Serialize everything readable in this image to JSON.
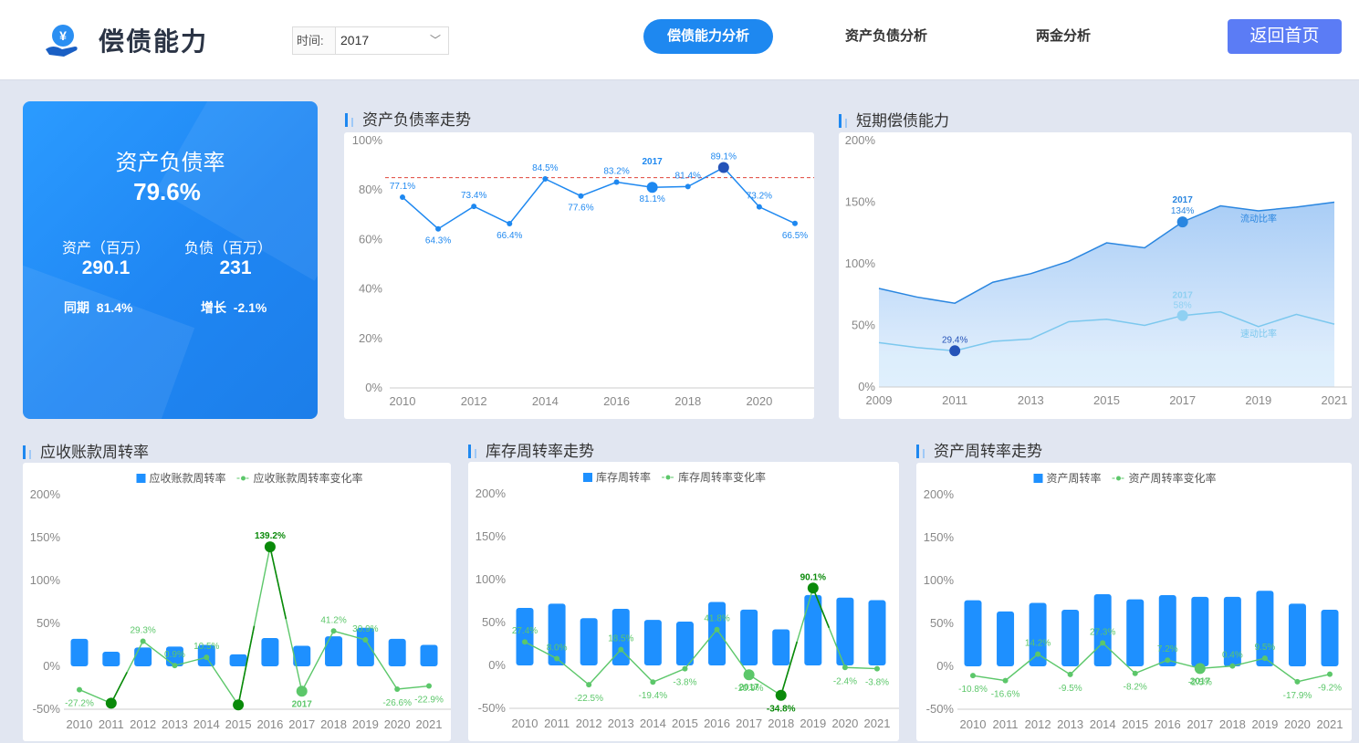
{
  "header": {
    "app_title": "偿债能力",
    "time_label": "时间:",
    "time_value": "2017",
    "tabs": [
      "偿债能力分析",
      "资产负债分析",
      "两金分析"
    ],
    "home_button": "返回首页",
    "logo_icon": "yuan-hand-icon"
  },
  "kpi": {
    "title": "资产负债率",
    "main_value": "79.6%",
    "assets_label": "资产（百万）",
    "assets_value": "290.1",
    "liabilities_label": "负债（百万）",
    "liabilities_value": "231",
    "yoy_label": "同期",
    "yoy_value": "81.4%",
    "growth_label": "增长",
    "growth_value": "-2.1%"
  },
  "titles": {
    "debt_ratio": "资产负债率走势",
    "short_term": "短期偿债能力",
    "receivable": "应收账款周转率",
    "inventory": "库存周转率走势",
    "asset_turnover": "资产周转率走势"
  },
  "colors": {
    "accent": "#1e88f0",
    "bar": "#1e90ff",
    "line_green": "#5cc76a",
    "highlight_green": "#0a8a0a",
    "dark_blue": "#2553b8",
    "warning_red": "#e0453a"
  },
  "chart_data": [
    {
      "type": "line",
      "id": "debt_ratio",
      "x": [
        2010,
        2011,
        2012,
        2013,
        2014,
        2015,
        2016,
        2017,
        2018,
        2019,
        2020,
        2021
      ],
      "series": [
        {
          "values": [
            77.1,
            64.3,
            73.4,
            66.4,
            84.5,
            77.6,
            83.2,
            81.1,
            81.4,
            89.1,
            73.2,
            66.5
          ]
        }
      ],
      "data_labels": [
        "77.1%",
        "64.3%",
        "73.4%",
        "66.4%",
        "84.5%",
        "77.6%",
        "83.2%",
        "81.1%",
        "81.4%",
        "89.1%",
        "73.2%",
        "66.5%"
      ],
      "x_ticks": [
        "2010",
        "2012",
        "2014",
        "2016",
        "2018",
        "2020"
      ],
      "y_ticks": [
        "0%",
        "20%",
        "40%",
        "60%",
        "80%",
        "100%"
      ],
      "ylim": [
        0,
        100
      ],
      "reference_line": 85,
      "highlight_year": "2017",
      "grid": false
    },
    {
      "type": "area",
      "id": "short_term",
      "x": [
        2009,
        2010,
        2011,
        2012,
        2013,
        2014,
        2015,
        2016,
        2017,
        2018,
        2019,
        2020,
        2021
      ],
      "series": [
        {
          "name": "流动比率",
          "values": [
            80,
            73,
            68,
            85,
            92,
            102,
            117,
            113,
            134,
            147,
            143,
            146,
            150
          ]
        },
        {
          "name": "速动比率",
          "values": [
            36,
            32,
            29.4,
            37,
            39,
            53,
            55,
            50,
            58,
            61,
            49,
            59,
            51
          ]
        }
      ],
      "x_ticks": [
        "2009",
        "2011",
        "2013",
        "2015",
        "2017",
        "2019",
        "2021"
      ],
      "y_ticks": [
        "0%",
        "50%",
        "100%",
        "150%",
        "200%"
      ],
      "ylim": [
        0,
        200
      ],
      "annotations": [
        {
          "year": "2017",
          "value_label": "134%",
          "series": "流动比率"
        },
        {
          "year": "2017",
          "value_label": "58%",
          "series": "速动比率"
        },
        {
          "value_label": "29.4%",
          "series": "速动比率",
          "at": 2011
        }
      ]
    },
    {
      "type": "bar",
      "id": "receivable",
      "x": [
        2010,
        2011,
        2012,
        2013,
        2014,
        2015,
        2016,
        2017,
        2018,
        2019,
        2020,
        2021
      ],
      "series": [
        {
          "name": "应收账款周转率",
          "values": [
            32,
            17,
            22,
            23,
            25,
            14,
            33,
            24,
            35,
            45,
            32,
            25
          ]
        },
        {
          "name": "应收账款周转率变化率",
          "values": [
            -27.2,
            -43,
            29.3,
            0.9,
            10.5,
            -45,
            139.2,
            -29,
            41.2,
            30.9,
            -26.6,
            -22.9
          ]
        }
      ],
      "labels": [
        "-27.2%",
        "",
        "29.3%",
        "0.9%",
        "10.5%",
        "",
        "139.2%",
        "",
        "41.2%",
        "30.9%",
        "-26.6%",
        "-22.9%"
      ],
      "highlight_year": "2017",
      "highlight_points": [
        1,
        5,
        6
      ],
      "y_ticks": [
        "-50%",
        "0%",
        "50%",
        "100%",
        "150%",
        "200%"
      ],
      "ylim": [
        -50,
        200
      ]
    },
    {
      "type": "bar",
      "id": "inventory",
      "x": [
        2010,
        2011,
        2012,
        2013,
        2014,
        2015,
        2016,
        2017,
        2018,
        2019,
        2020,
        2021
      ],
      "series": [
        {
          "name": "库存周转率",
          "values": [
            67,
            72,
            55,
            66,
            53,
            51,
            74,
            65,
            42,
            82,
            79,
            76
          ]
        },
        {
          "name": "库存周转率变化率",
          "values": [
            27.4,
            8,
            -22.5,
            18.5,
            -19.4,
            -3.8,
            41.8,
            -10.9,
            -34.8,
            90.1,
            -2.4,
            -3.8
          ]
        }
      ],
      "labels": [
        "27.4%",
        "8.0%",
        "-22.5%",
        "18.5%",
        "-19.4%",
        "-3.8%",
        "41.8%",
        "-10.9%",
        "-34.8%",
        "90.1%",
        "-2.4%",
        "-3.8%"
      ],
      "highlight_year": "2017",
      "highlight_points": [
        8,
        9
      ],
      "y_ticks": [
        "-50%",
        "0%",
        "50%",
        "100%",
        "150%",
        "200%"
      ],
      "ylim": [
        -50,
        200
      ]
    },
    {
      "type": "bar",
      "id": "asset_turnover",
      "x": [
        2010,
        2011,
        2012,
        2013,
        2014,
        2015,
        2016,
        2017,
        2018,
        2019,
        2020,
        2021
      ],
      "series": [
        {
          "name": "资产周转率",
          "values": [
            77,
            64,
            74,
            66,
            84,
            78,
            83,
            81,
            81,
            88,
            73,
            66
          ]
        },
        {
          "name": "资产周转率变化率",
          "values": [
            -10.8,
            -16.6,
            14.2,
            -9.5,
            27.3,
            -8.2,
            7.2,
            -2.5,
            0.4,
            9.5,
            -17.9,
            -9.2
          ]
        }
      ],
      "labels": [
        "-10.8%",
        "-16.6%",
        "14.2%",
        "-9.5%",
        "27.3%",
        "-8.2%",
        "7.2%",
        "-2.5%",
        "0.4%",
        "9.5%",
        "-17.9%",
        "-9.2%"
      ],
      "highlight_year": "2017",
      "highlight_points": [],
      "y_ticks": [
        "-50%",
        "0%",
        "50%",
        "100%",
        "150%",
        "200%"
      ],
      "ylim": [
        -50,
        200
      ]
    }
  ]
}
